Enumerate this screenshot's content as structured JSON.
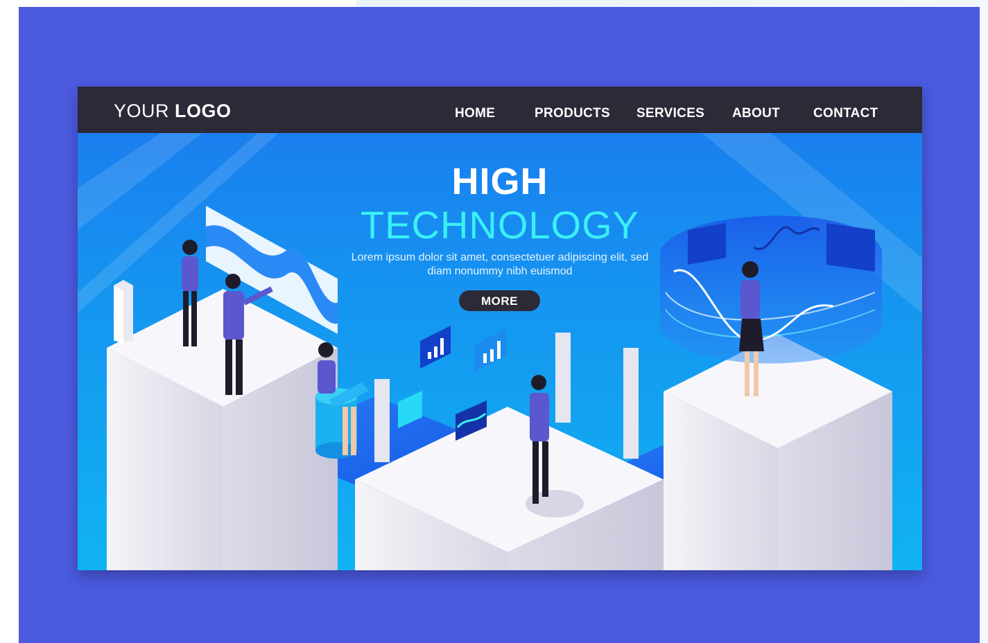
{
  "brand": {
    "logo_regular": "YOUR",
    "logo_bold": "LOGO"
  },
  "nav": {
    "items": [
      {
        "label": "HOME"
      },
      {
        "label": "PRODUCTS"
      },
      {
        "label": "SERVICES"
      },
      {
        "label": "ABOUT"
      },
      {
        "label": "CONTACT"
      }
    ]
  },
  "hero": {
    "headline": "HIGH",
    "subheadline": "TECHNOLOGY",
    "tagline": "Lorem ipsum dolor sit amet, consectetuer adipiscing elit, sed diam nonummy nibh euismod",
    "more_label": "MORE"
  },
  "colors": {
    "backdrop": "#4b5ade",
    "navbar": "#2b2a36",
    "hero_top": "#1a7fef",
    "hero_bottom": "#10b3f2",
    "accent_cyan": "#3af0f4",
    "button": "#2b2a36"
  },
  "icons": [
    "bar-chart-icon",
    "area-chart-icon",
    "wave-chart-icon"
  ]
}
